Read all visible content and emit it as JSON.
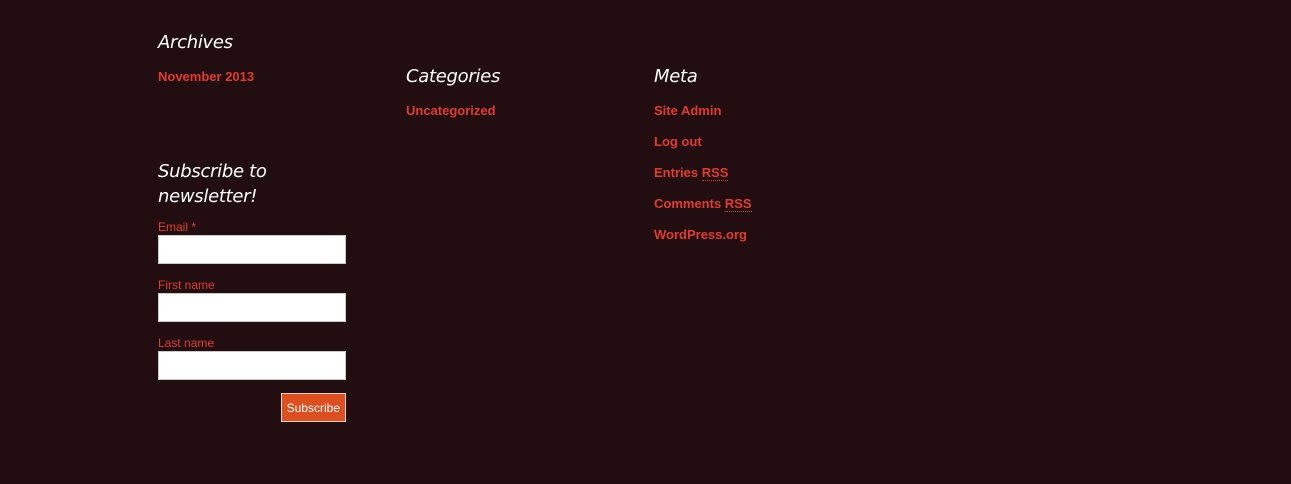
{
  "archives": {
    "title": "Archives",
    "items": [
      "November 2013"
    ]
  },
  "categories": {
    "title": "Categories",
    "items": [
      "Uncategorized"
    ]
  },
  "meta": {
    "title": "Meta",
    "site_admin": "Site Admin",
    "log_out": "Log out",
    "entries_prefix": "Entries ",
    "comments_prefix": "Comments ",
    "rss_abbr": "RSS",
    "wordpress": "WordPress.org"
  },
  "subscribe": {
    "title": "Subscribe to newsletter!",
    "email_label": "Email *",
    "first_name_label": "First name",
    "last_name_label": "Last name",
    "email_value": "",
    "first_name_value": "",
    "last_name_value": "",
    "button_label": "Subscribe"
  },
  "colors": {
    "background": "#220e10",
    "link": "#e23b2e",
    "button": "#dd4f1e",
    "heading": "#ffffff"
  }
}
